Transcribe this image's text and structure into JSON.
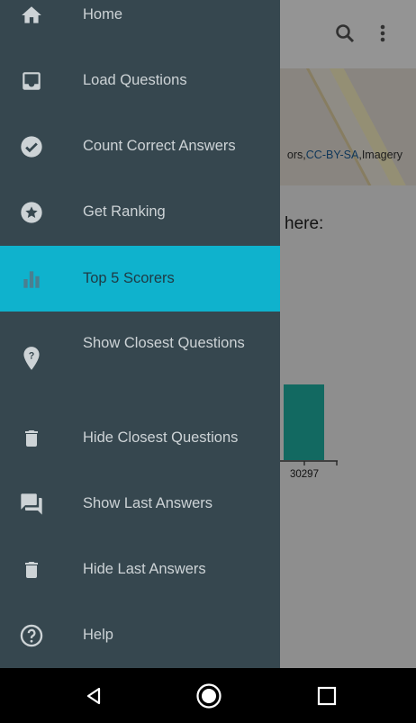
{
  "app": {
    "map_attribution": {
      "prefix": "ors,",
      "license": "CC-BY-SA",
      "suffix": ",Imagery"
    },
    "prompt_text": "here:",
    "chart_label": "30297"
  },
  "drawer": {
    "items": [
      {
        "label": "Home",
        "icon": "home-icon"
      },
      {
        "label": "Load Questions",
        "icon": "inbox-icon"
      },
      {
        "label": "Count Correct Answers",
        "icon": "check-circle-icon"
      },
      {
        "label": "Get Ranking",
        "icon": "star-circle-icon"
      },
      {
        "label": "Top 5 Scorers",
        "icon": "bar-chart-icon",
        "active": true
      },
      {
        "label": "Show Closest Questions",
        "icon": "map-pin-question-icon"
      },
      {
        "label": "Hide Closest Questions",
        "icon": "trash-icon"
      },
      {
        "label": "Show Last Answers",
        "icon": "chat-icon"
      },
      {
        "label": "Hide Last Answers",
        "icon": "trash-icon"
      },
      {
        "label": "Help",
        "icon": "help-circle-icon"
      }
    ]
  },
  "colors": {
    "drawer_bg": "#36474f",
    "active_bg": "#0fb2cd",
    "icon": "#cdd3d6"
  }
}
